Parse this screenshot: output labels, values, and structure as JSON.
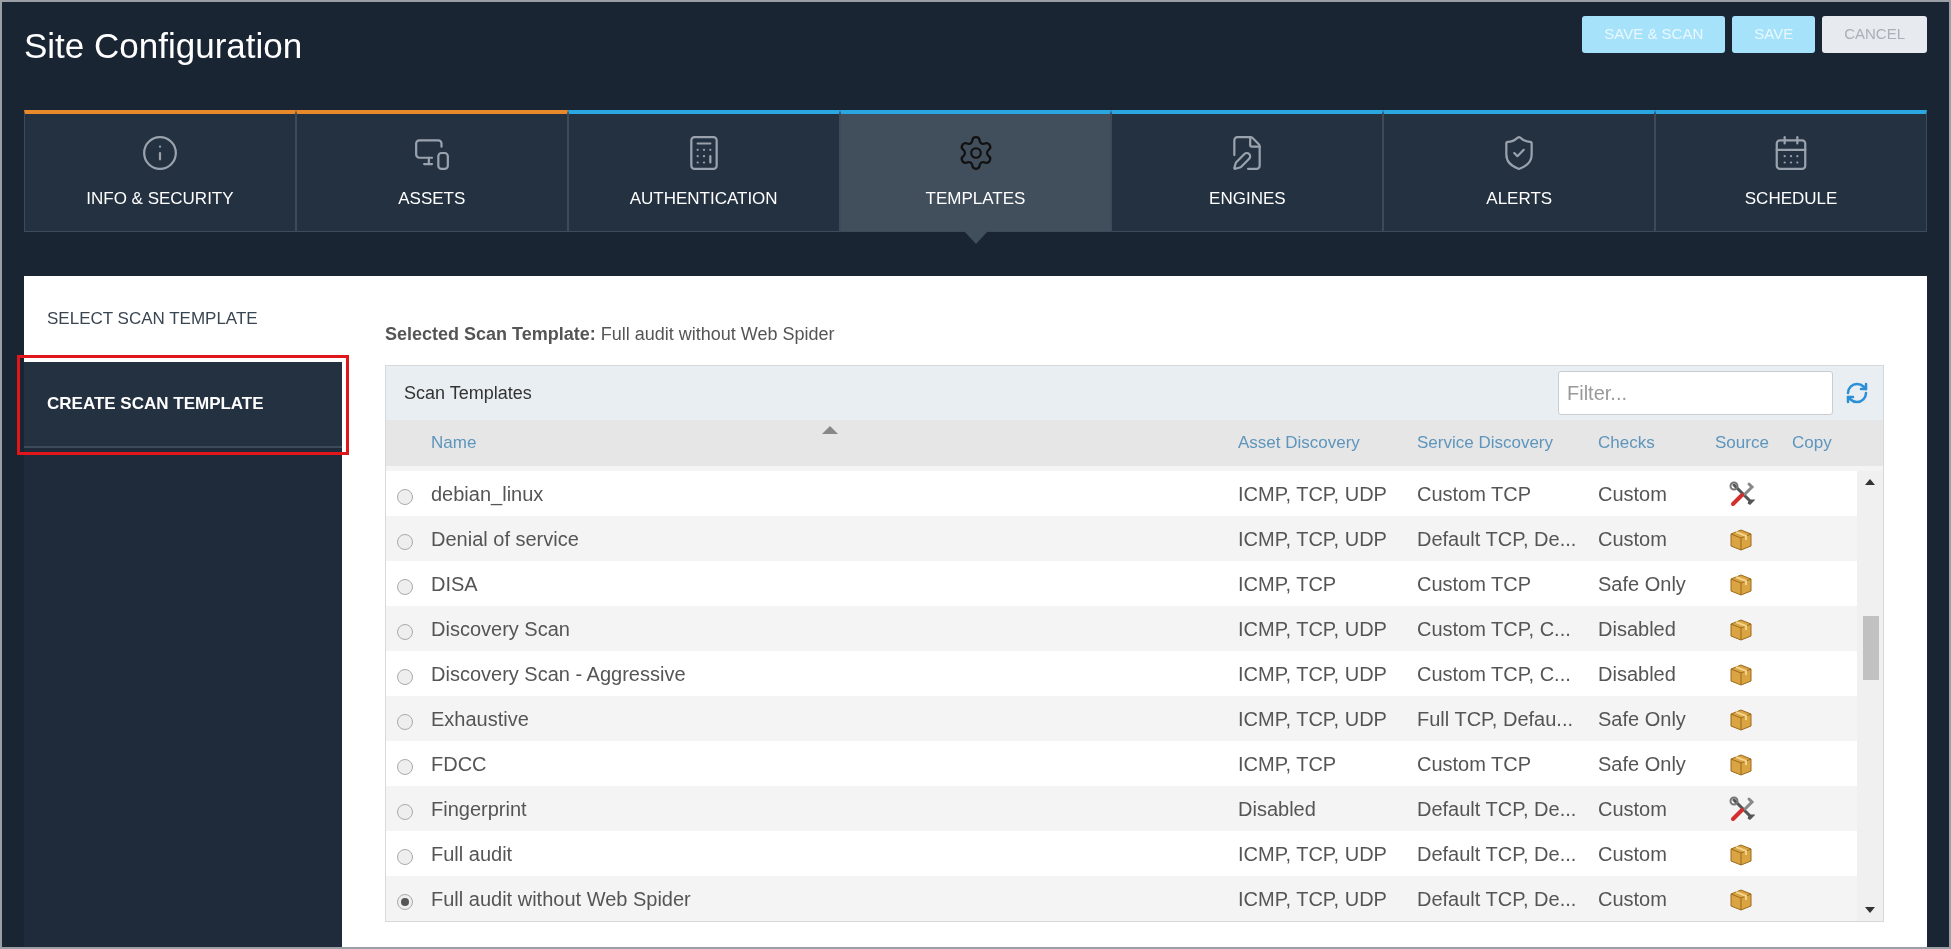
{
  "window": {
    "title": "Site Configuration"
  },
  "actions": [
    {
      "label": "SAVE & SCAN",
      "kind": "primary"
    },
    {
      "label": "SAVE",
      "kind": "primary"
    },
    {
      "label": "CANCEL",
      "kind": "secondary"
    }
  ],
  "tabs": [
    {
      "label": "INFO & SECURITY",
      "selected": false,
      "color": "#e8892b"
    },
    {
      "label": "ASSETS",
      "selected": false,
      "color": "#e8892b"
    },
    {
      "label": "AUTHENTICATION",
      "selected": false,
      "color": "#2aa7e0"
    },
    {
      "label": "TEMPLATES",
      "selected": true,
      "color": "#2aa7e0"
    },
    {
      "label": "ENGINES",
      "selected": false,
      "color": "#2aa7e0"
    },
    {
      "label": "ALERTS",
      "selected": false,
      "color": "#2aa7e0"
    },
    {
      "label": "SCHEDULE",
      "selected": false,
      "color": "#2aa7e0"
    }
  ],
  "sidebar": {
    "items": [
      {
        "label": "SELECT SCAN TEMPLATE",
        "selected": true,
        "highlighted": false
      },
      {
        "label": "CREATE SCAN TEMPLATE",
        "selected": false,
        "highlighted": true
      }
    ]
  },
  "selected_template": {
    "label": "Selected Scan Template:",
    "value": "Full audit without Web Spider"
  },
  "table": {
    "title": "Scan Templates",
    "filter": {
      "placeholder": "Filter..."
    },
    "columns": [
      "Name",
      "Asset Discovery",
      "Service Discovery",
      "Checks",
      "Source",
      "Copy"
    ],
    "rows": [
      {
        "name": "debian_linux",
        "asset_discovery": "ICMP, TCP, UDP",
        "service_discovery": "Custom TCP",
        "checks": "Custom",
        "kind": "custom",
        "selected": false
      },
      {
        "name": "Denial of service",
        "asset_discovery": "ICMP, TCP, UDP",
        "service_discovery": "Default TCP, De...",
        "checks": "Custom",
        "kind": "builtin",
        "selected": false
      },
      {
        "name": "DISA",
        "asset_discovery": "ICMP, TCP",
        "service_discovery": "Custom TCP",
        "checks": "Safe Only",
        "kind": "builtin",
        "selected": false
      },
      {
        "name": "Discovery Scan",
        "asset_discovery": "ICMP, TCP, UDP",
        "service_discovery": "Custom TCP, C...",
        "checks": "Disabled",
        "kind": "builtin",
        "selected": false
      },
      {
        "name": "Discovery Scan - Aggressive",
        "asset_discovery": "ICMP, TCP, UDP",
        "service_discovery": "Custom TCP, C...",
        "checks": "Disabled",
        "kind": "builtin",
        "selected": false
      },
      {
        "name": "Exhaustive",
        "asset_discovery": "ICMP, TCP, UDP",
        "service_discovery": "Full TCP, Defau...",
        "checks": "Safe Only",
        "kind": "builtin",
        "selected": false
      },
      {
        "name": "FDCC",
        "asset_discovery": "ICMP, TCP",
        "service_discovery": "Custom TCP",
        "checks": "Safe Only",
        "kind": "builtin",
        "selected": false
      },
      {
        "name": "Fingerprint",
        "asset_discovery": "Disabled",
        "service_discovery": "Default TCP, De...",
        "checks": "Custom",
        "kind": "custom",
        "selected": false
      },
      {
        "name": "Full audit",
        "asset_discovery": "ICMP, TCP, UDP",
        "service_discovery": "Default TCP, De...",
        "checks": "Custom",
        "kind": "builtin",
        "selected": false
      },
      {
        "name": "Full audit without Web Spider",
        "asset_discovery": "ICMP, TCP, UDP",
        "service_discovery": "Default TCP, De...",
        "checks": "Custom",
        "kind": "builtin",
        "selected": true
      }
    ]
  }
}
